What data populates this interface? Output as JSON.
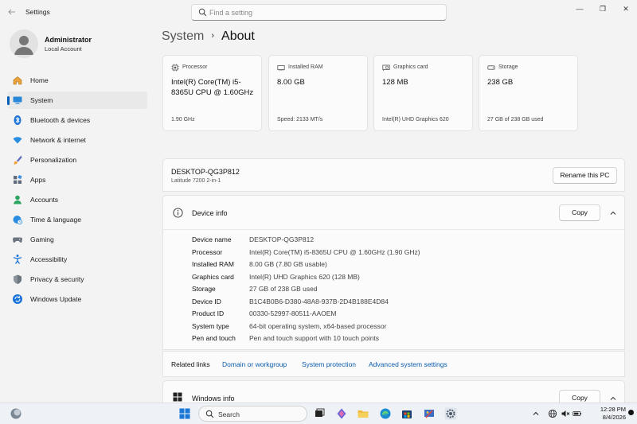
{
  "window": {
    "app_title": "Settings",
    "minimize": "—",
    "maximize": "❐",
    "close": "✕"
  },
  "search": {
    "placeholder": "Find a setting"
  },
  "profile": {
    "name": "Administrator",
    "account_type": "Local Account"
  },
  "nav": {
    "items": [
      {
        "label": "Home",
        "icon": "home-icon"
      },
      {
        "label": "System",
        "icon": "system-icon",
        "active": true
      },
      {
        "label": "Bluetooth & devices",
        "icon": "bluetooth-icon"
      },
      {
        "label": "Network & internet",
        "icon": "wifi-icon"
      },
      {
        "label": "Personalization",
        "icon": "paintbrush-icon"
      },
      {
        "label": "Apps",
        "icon": "apps-icon"
      },
      {
        "label": "Accounts",
        "icon": "accounts-icon"
      },
      {
        "label": "Time & language",
        "icon": "globe-clock-icon"
      },
      {
        "label": "Gaming",
        "icon": "gamepad-icon"
      },
      {
        "label": "Accessibility",
        "icon": "accessibility-icon"
      },
      {
        "label": "Privacy & security",
        "icon": "shield-icon"
      },
      {
        "label": "Windows Update",
        "icon": "update-icon"
      }
    ]
  },
  "breadcrumb": {
    "parent": "System",
    "separator": "›",
    "current": "About"
  },
  "cards": [
    {
      "label": "Processor",
      "value": "Intel(R) Core(TM) i5-8365U CPU @ 1.60GHz",
      "sub": "1.90 GHz",
      "icon": "processor-icon"
    },
    {
      "label": "Installed RAM",
      "value": "8.00 GB",
      "sub": "Speed: 2133 MT/s",
      "icon": "ram-icon"
    },
    {
      "label": "Graphics card",
      "value": "128 MB",
      "sub": "Intel(R) UHD Graphics 620",
      "icon": "graphics-card-icon"
    },
    {
      "label": "Storage",
      "value": "238 GB",
      "sub": "27 GB of 238 GB used",
      "icon": "storage-icon"
    }
  ],
  "pc": {
    "name": "DESKTOP-QG3P812",
    "model": "Latitude 7200 2-in-1",
    "rename_label": "Rename this PC"
  },
  "device_info": {
    "title": "Device info",
    "copy_label": "Copy",
    "specs": [
      {
        "key": "Device name",
        "value": "DESKTOP-QG3P812"
      },
      {
        "key": "Processor",
        "value": "Intel(R) Core(TM) i5-8365U CPU @ 1.60GHz (1.90 GHz)"
      },
      {
        "key": "Installed RAM",
        "value": "8.00 GB (7.80 GB usable)"
      },
      {
        "key": "Graphics card",
        "value": "Intel(R) UHD Graphics 620 (128 MB)"
      },
      {
        "key": "Storage",
        "value": "27 GB of 238 GB used"
      },
      {
        "key": "Device ID",
        "value": "B1C4B0B6-D380-48A8-937B-2D4B188E4D84"
      },
      {
        "key": "Product ID",
        "value": "00330-52997-80511-AAOEM"
      },
      {
        "key": "System type",
        "value": "64-bit operating system, x64-based processor"
      },
      {
        "key": "Pen and touch",
        "value": "Pen and touch support with 10 touch points"
      }
    ]
  },
  "related": {
    "label": "Related links",
    "links": [
      "Domain or workgroup",
      "System protection",
      "Advanced system settings"
    ]
  },
  "windows_info": {
    "title": "Windows info",
    "copy_label": "Copy"
  },
  "taskbar": {
    "search_label": "Search",
    "time": "12:28 PM",
    "date": "8/4/2026"
  },
  "colors": {
    "accent": "#005fb8",
    "link": "#0b5cad",
    "background": "#f3f3f3",
    "card": "#fbfbfb"
  }
}
